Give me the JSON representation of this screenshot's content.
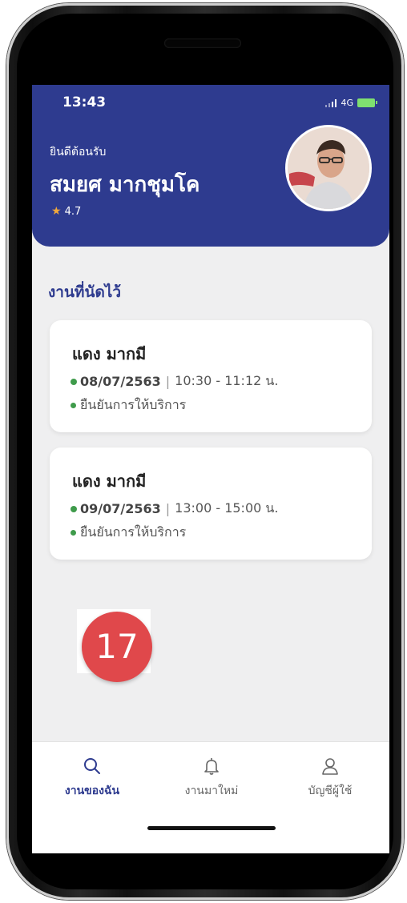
{
  "status_bar": {
    "time": "13:43",
    "network": "4G"
  },
  "header": {
    "welcome": "ยินดีต้อนรับ",
    "user_name": "สมยศ มากชุมโค",
    "rating": "4.7"
  },
  "section_title": "งานที่นัดไว้",
  "appointments": [
    {
      "name": "แดง มากมี",
      "date": "08/07/2563",
      "time": "10:30 - 11:12 น.",
      "status": "ยืนยันการให้บริการ"
    },
    {
      "name": "แดง มากมี",
      "date": "09/07/2563",
      "time": "13:00 - 15:00 น.",
      "status": "ยืนยันการให้บริการ"
    }
  ],
  "tabs": [
    {
      "label": "งานของฉัน",
      "icon": "search-icon",
      "active": true
    },
    {
      "label": "งานมาใหม่",
      "icon": "bell-icon",
      "active": false
    },
    {
      "label": "บัญชีผู้ใช้",
      "icon": "user-icon",
      "active": false
    }
  ],
  "badge": "17",
  "colors": {
    "primary": "#2e3b8f",
    "status_green": "#3f9b4b",
    "star": "#f2a93b",
    "badge": "#e0484b"
  }
}
